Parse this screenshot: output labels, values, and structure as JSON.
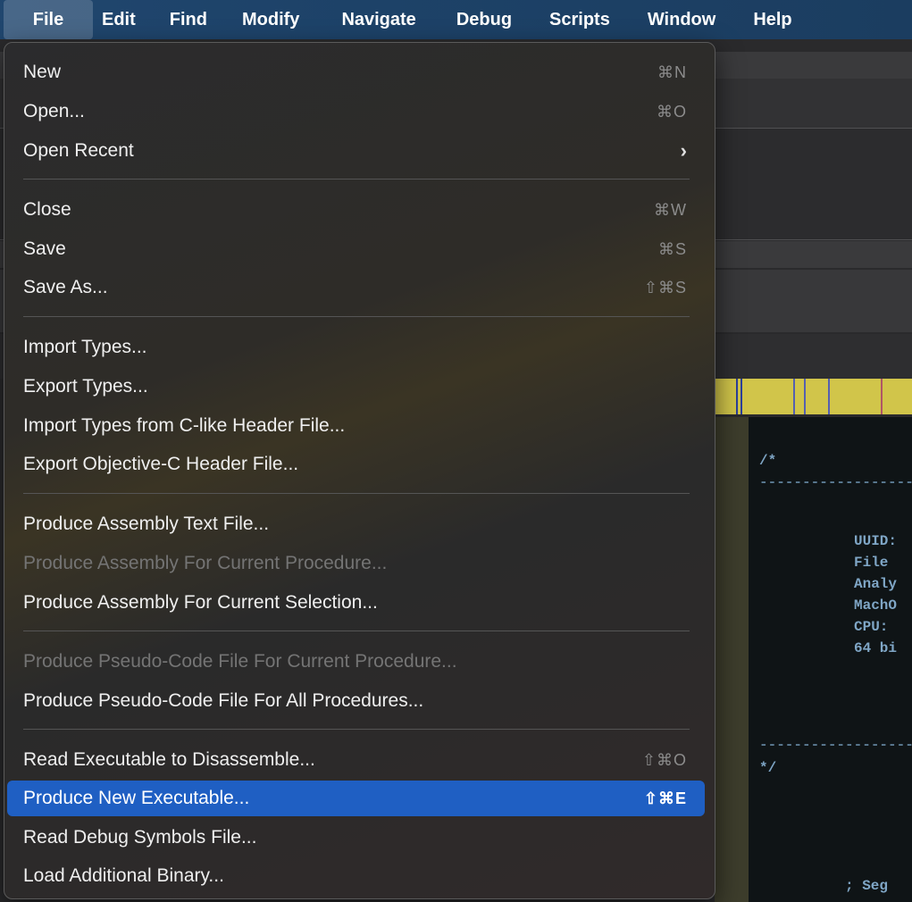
{
  "menubar": {
    "items": [
      {
        "label": "File",
        "active": true
      },
      {
        "label": "Edit"
      },
      {
        "label": "Find"
      },
      {
        "label": "Modify"
      },
      {
        "label": "Navigate"
      },
      {
        "label": "Debug"
      },
      {
        "label": "Scripts"
      },
      {
        "label": "Window"
      },
      {
        "label": "Help"
      }
    ]
  },
  "file_menu": {
    "items": [
      {
        "label": "New",
        "shortcut": "⌘N"
      },
      {
        "label": "Open...",
        "shortcut": "⌘O"
      },
      {
        "label": "Open Recent",
        "submenu": "›"
      },
      {
        "label": "Close",
        "shortcut": "⌘W"
      },
      {
        "label": "Save",
        "shortcut": "⌘S"
      },
      {
        "label": "Save As...",
        "shortcut": "⇧⌘S"
      },
      {
        "label": "Import Types..."
      },
      {
        "label": "Export Types..."
      },
      {
        "label": "Import Types from C-like Header File..."
      },
      {
        "label": "Export Objective-C Header File..."
      },
      {
        "label": "Produce Assembly Text File..."
      },
      {
        "label": "Produce Assembly For Current Procedure...",
        "disabled": true
      },
      {
        "label": "Produce Assembly For Current Selection..."
      },
      {
        "label": "Produce Pseudo-Code File For Current Procedure...",
        "disabled": true
      },
      {
        "label": "Produce Pseudo-Code File For All Procedures..."
      },
      {
        "label": "Read Executable to Disassemble...",
        "shortcut": "⇧⌘O"
      },
      {
        "label": "Produce New Executable...",
        "shortcut": "⇧⌘E",
        "highlighted": true
      },
      {
        "label": "Read Debug Symbols File..."
      },
      {
        "label": "Load Additional Binary..."
      }
    ]
  },
  "code_view": {
    "lines": [
      "/*",
      "UUID:",
      "File",
      "Analy",
      "MachO",
      "CPU:",
      "64 bi",
      "*/",
      "; Seg"
    ]
  },
  "colors": {
    "menubar": "#1d4268",
    "highlight": "#1f5fc3",
    "navigation_bar": "#d1c54a",
    "code_text": "#7fa6c6"
  }
}
